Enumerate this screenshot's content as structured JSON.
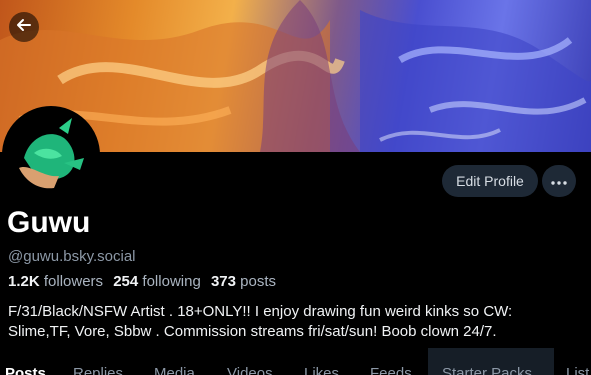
{
  "profile": {
    "display_name": "Guwu",
    "handle": "@guwu.bsky.social",
    "bio_line1": "F/31/Black/NSFW Artist . 18+ONLY!! I enjoy drawing fun weird kinks so CW:",
    "bio_line2": "Slime,TF, Vore, Sbbw .  Commission streams fri/sat/sun! Boob clown 24/7."
  },
  "stats": {
    "followers_count": "1.2K",
    "followers_label": "followers",
    "following_count": "254",
    "following_label": "following",
    "posts_count": "373",
    "posts_label": "posts"
  },
  "actions": {
    "edit_profile_label": "Edit Profile",
    "more_label": "•••"
  },
  "tabs": [
    "Posts",
    "Replies",
    "Media",
    "Videos",
    "Likes",
    "Feeds",
    "Starter Packs",
    "List"
  ],
  "icons": {
    "back": "arrow-left-icon",
    "more": "ellipsis-icon"
  },
  "colors": {
    "background": "#000000",
    "button_bg": "#1e2936",
    "muted_text": "#8c98a6",
    "banner_orange": "#e48a2a",
    "banner_blue": "#4a4fd0"
  }
}
